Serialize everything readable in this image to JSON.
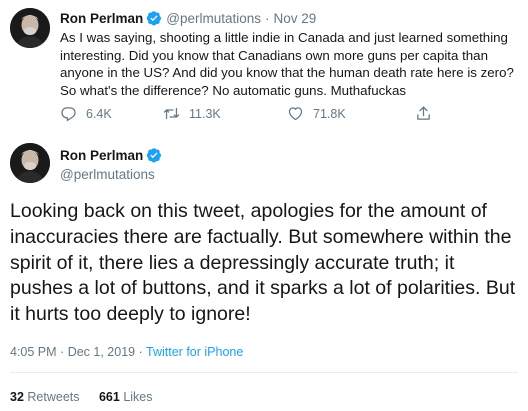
{
  "tweet1": {
    "name": "Ron Perlman",
    "handle": "@perlmutations",
    "separator": "·",
    "date": "Nov 29",
    "text": "As I was saying, shooting a little indie in Canada and just learned something interesting. Did you know that Canadians own more guns per capita than anyone in the US? And did you know that the human death rate here is zero? So what's the difference? No automatic guns. Muthafuckas",
    "replies": "6.4K",
    "retweets": "11.3K",
    "likes": "71.8K"
  },
  "tweet2": {
    "name": "Ron Perlman",
    "handle": "@perlmutations",
    "text": "Looking back on this tweet, apologies for the amount of inaccuracies there are factually. But somewhere within the spirit of it, there lies a depressingly accurate truth; it pushes a lot of buttons, and it sparks a lot of polarities. But it hurts too deeply to ignore!",
    "time": "4:05 PM",
    "separator": "·",
    "date": "Dec 1, 2019",
    "source": "Twitter for iPhone",
    "retweet_count": "32",
    "retweet_label": "Retweets",
    "like_count": "661",
    "like_label": "Likes"
  },
  "icons": {
    "verified": "verified-badge-icon",
    "reply": "reply-icon",
    "retweet": "retweet-icon",
    "like": "heart-icon",
    "share": "share-icon"
  },
  "colors": {
    "text": "#14171a",
    "secondary": "#657786",
    "accent": "#1da1f2",
    "divider": "#e6ecf0"
  }
}
